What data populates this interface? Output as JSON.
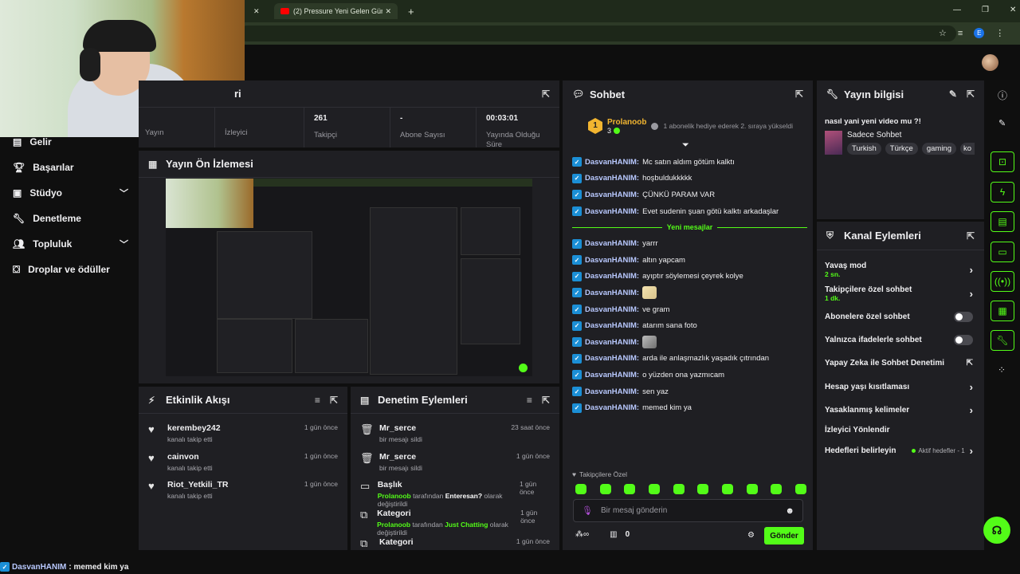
{
  "browser": {
    "tab_title": "(2) Pressure Yeni Gelen Günce..."
  },
  "stats": {
    "header": "ri",
    "items": [
      {
        "value": "",
        "label": "Yayın"
      },
      {
        "value": "",
        "label": "İzleyici"
      },
      {
        "value": "261",
        "label": "Takipçi"
      },
      {
        "value": "-",
        "label": "Abone Sayısı"
      },
      {
        "value": "00:03:01",
        "label": "Yayında Olduğu Süre"
      }
    ]
  },
  "sidebar": {
    "items": [
      {
        "label": "Gelir",
        "icon": "wallet-icon"
      },
      {
        "label": "Başarılar",
        "icon": "trophy-icon"
      },
      {
        "label": "Stüdyo",
        "icon": "studio-icon"
      },
      {
        "label": "Denetleme",
        "icon": "wrench-icon"
      },
      {
        "label": "Topluluk",
        "icon": "people-icon"
      },
      {
        "label": "Droplar ve ödüller",
        "icon": "drops-icon"
      }
    ]
  },
  "preview": {
    "title": "Yayın Ön İzlemesi"
  },
  "activity": {
    "title": "Etkinlik Akışı",
    "rows": [
      {
        "name": "kerembey242",
        "sub": "kanalı takip etti",
        "time": "1 gün önce"
      },
      {
        "name": "cainvon",
        "sub": "kanalı takip etti",
        "time": "1 gün önce"
      },
      {
        "name": "Riot_Yetkili_TR",
        "sub": "kanalı takip etti",
        "time": "1 gün önce"
      }
    ]
  },
  "moderation": {
    "title": "Denetim Eylemleri",
    "rows": [
      {
        "name": "Mr_serce",
        "sub_pre": "bir mesajı sildi",
        "sub_green": "",
        "sub_mid": "",
        "sub_green2": "",
        "sub_post": "",
        "time": "23 saat önce"
      },
      {
        "name": "Mr_serce",
        "sub_pre": "bir mesajı sildi",
        "sub_green": "",
        "sub_mid": "",
        "sub_green2": "",
        "sub_post": "",
        "time": "1 gün önce"
      },
      {
        "name": "Başlık",
        "sub_pre": "",
        "sub_green": "Prolanoob",
        "sub_mid": " tarafından ",
        "sub_green2": "Enteresan?",
        "sub_post": " olarak değiştirildi",
        "time": "1 gün önce"
      },
      {
        "name": "Kategori",
        "sub_pre": "",
        "sub_green": "Prolanoob",
        "sub_mid": " tarafından ",
        "sub_green2": "Just Chatting",
        "sub_post": " olarak değiştirildi",
        "time": "1 gün önce"
      },
      {
        "name": "Kategori",
        "sub_pre": "",
        "sub_green": "",
        "sub_mid": "",
        "sub_green2": "",
        "sub_post": "",
        "time": "1 gün önce"
      }
    ]
  },
  "chat": {
    "title": "Sohbet",
    "pinned_user": "Prolanoob",
    "pinned_count": "3",
    "pinned_text": "1 abonelik hediye ederek 2. sıraya yükseldi",
    "new_messages_label": "Yeni mesajlar",
    "messages_before": [
      {
        "user": "DasvanHANIM:",
        "text": "Mc satın aldım götüm kalktı"
      },
      {
        "user": "DasvanHANIM:",
        "text": "hoşbuldukkkkk"
      },
      {
        "user": "DasvanHANIM:",
        "text": "ÇÜNKÜ PARAM VAR"
      },
      {
        "user": "DasvanHANIM:",
        "text": "Evet sudenin şuan götü kalktı arkadaşlar"
      }
    ],
    "messages_after": [
      {
        "user": "DasvanHANIM:",
        "text": "yarrr",
        "emote": ""
      },
      {
        "user": "DasvanHANIM:",
        "text": "altın yapcam",
        "emote": ""
      },
      {
        "user": "DasvanHANIM:",
        "text": "ayıptır söylemesi çeyrek kolye",
        "emote": ""
      },
      {
        "user": "DasvanHANIM:",
        "text": "",
        "emote": "emote"
      },
      {
        "user": "DasvanHANIM:",
        "text": "ve gram",
        "emote": ""
      },
      {
        "user": "DasvanHANIM:",
        "text": "atarım sana foto",
        "emote": ""
      },
      {
        "user": "DasvanHANIM:",
        "text": "",
        "emote": "cat"
      },
      {
        "user": "DasvanHANIM:",
        "text": "arda ile anlaşmazlık yaşadık çıtrından",
        "emote": ""
      },
      {
        "user": "DasvanHANIM:",
        "text": "o yüzden ona yazmıcam",
        "emote": ""
      },
      {
        "user": "DasvanHANIM:",
        "text": "sen yaz",
        "emote": ""
      },
      {
        "user": "DasvanHANIM:",
        "text": "memed kim ya",
        "emote": ""
      }
    ],
    "followers_only": "Takipçilere Özel",
    "input_placeholder": "Bir mesaj gönderin",
    "points": "0",
    "send_label": "Gönder"
  },
  "stream_info": {
    "title": "Yayın bilgisi",
    "stream_title": "nasıl yani yeni video mu ?!",
    "category": "Sadece Sohbet",
    "tags": [
      "Turkish",
      "Türkçe",
      "gaming",
      "ko"
    ]
  },
  "channel_actions": {
    "title": "Kanal Eylemleri",
    "items": [
      {
        "label": "Yavaş mod",
        "sub": "2 sn.",
        "control": "chevron"
      },
      {
        "label": "Takipçilere özel sohbet",
        "sub": "1 dk.",
        "control": "chevron"
      },
      {
        "label": "Abonelere özel sohbet",
        "sub": "",
        "control": "toggle"
      },
      {
        "label": "Yalnızca ifadelerle sohbet",
        "sub": "",
        "control": "toggle"
      },
      {
        "label": "Yapay Zeka ile Sohbet Denetimi",
        "sub": "",
        "control": "external"
      },
      {
        "label": "Hesap yaşı kısıtlaması",
        "sub": "",
        "control": "chevron"
      },
      {
        "label": "Yasaklanmış kelimeler",
        "sub": "",
        "control": "chevron"
      },
      {
        "label": "İzleyici Yönlendir",
        "sub": "",
        "control": "none"
      },
      {
        "label": "Hedefleri belirleyin",
        "sub": "",
        "control": "chevron"
      }
    ],
    "goals_status": "Aktif hedefler - 1"
  },
  "overlay": {
    "chat_line_user": "DasvanHANIM",
    "chat_line_text": ": memed kim ya"
  },
  "colors": {
    "accent": "#53fc18",
    "panel": "#1f1f23",
    "background": "#0f0f0f"
  }
}
